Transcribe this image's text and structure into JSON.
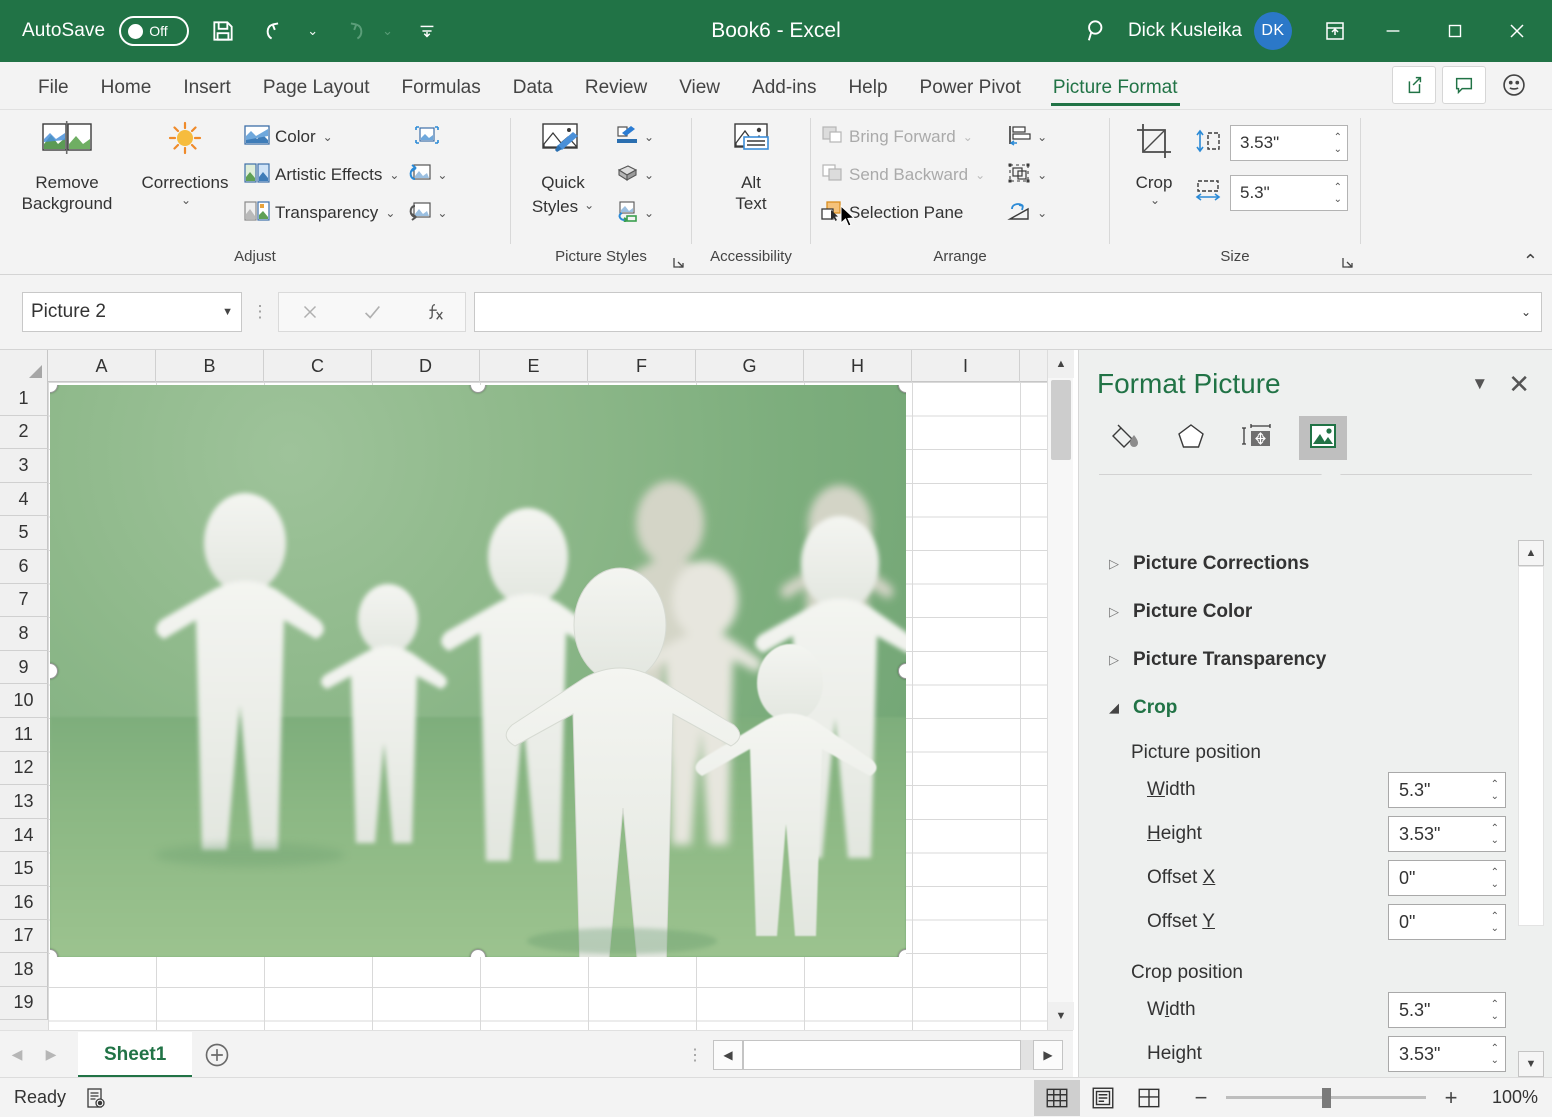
{
  "titlebar": {
    "autosave_label": "AutoSave",
    "autosave_state": "Off",
    "save_icon": "save-icon",
    "undo_icon": "undo-icon",
    "redo_icon": "redo-icon",
    "customize_qat_icon": "customize-quick-access-toolbar-icon",
    "document_title": "Book6  -  Excel",
    "search_icon": "search-icon",
    "user_name": "Dick Kusleika",
    "avatar_initials": "DK",
    "ribbon_display_icon": "ribbon-display-options-icon",
    "minimize_icon": "minimize-icon",
    "restore_icon": "restore-icon",
    "close_icon": "close-icon",
    "bg_color": "#217346"
  },
  "tabs": [
    {
      "label": "File",
      "active": false
    },
    {
      "label": "Home",
      "active": false
    },
    {
      "label": "Insert",
      "active": false
    },
    {
      "label": "Page Layout",
      "active": false
    },
    {
      "label": "Formulas",
      "active": false
    },
    {
      "label": "Data",
      "active": false
    },
    {
      "label": "Review",
      "active": false
    },
    {
      "label": "View",
      "active": false
    },
    {
      "label": "Add-ins",
      "active": false
    },
    {
      "label": "Help",
      "active": false
    },
    {
      "label": "Power Pivot",
      "active": false
    },
    {
      "label": "Picture Format",
      "active": true
    }
  ],
  "tabstrip_right": {
    "share_icon": "share-icon",
    "comments_icon": "comments-icon",
    "feedback_icon": "smiley-feedback-icon"
  },
  "ribbon": {
    "groups": [
      {
        "name": "Adjust",
        "big_buttons": [
          {
            "label_line1": "Remove",
            "label_line2": "Background",
            "icon": "remove-background-icon"
          },
          {
            "label_line1": "Corrections",
            "label_line2": "",
            "icon": "corrections-icon",
            "has_caret": true
          }
        ],
        "small_buttons": [
          {
            "label": "Color",
            "icon": "picture-color-icon",
            "caret": true
          },
          {
            "label": "Artistic Effects",
            "icon": "artistic-effects-icon",
            "caret": true
          },
          {
            "label": "Transparency",
            "icon": "picture-transparency-icon",
            "caret": true
          }
        ],
        "icon_buttons": [
          {
            "icon": "compress-pictures-icon",
            "caret": false
          },
          {
            "icon": "change-picture-icon",
            "caret": true
          },
          {
            "icon": "reset-picture-icon",
            "caret": true
          }
        ]
      },
      {
        "name": "Picture Styles",
        "big_buttons": [
          {
            "label_line1": "Quick",
            "label_line2": "Styles",
            "icon": "quick-styles-icon",
            "inline_caret": true
          }
        ],
        "icon_buttons": [
          {
            "icon": "picture-border-icon",
            "caret": true
          },
          {
            "icon": "picture-effects-icon",
            "caret": true
          },
          {
            "icon": "picture-layout-icon",
            "caret": true
          }
        ],
        "has_dialog_launcher": true
      },
      {
        "name": "Accessibility",
        "big_buttons": [
          {
            "label_line1": "Alt",
            "label_line2": "Text",
            "icon": "alt-text-icon"
          }
        ]
      },
      {
        "name": "Arrange",
        "small_buttons": [
          {
            "label": "Bring Forward",
            "icon": "bring-forward-icon",
            "caret": true,
            "disabled": true
          },
          {
            "label": "Send Backward",
            "icon": "send-backward-icon",
            "caret": true,
            "disabled": true
          },
          {
            "label": "Selection Pane",
            "icon": "selection-pane-icon",
            "caret": false,
            "disabled": false
          }
        ],
        "icon_buttons": [
          {
            "icon": "align-objects-icon",
            "caret": true
          },
          {
            "icon": "group-objects-icon",
            "caret": true
          },
          {
            "icon": "rotate-objects-icon",
            "caret": true
          }
        ]
      },
      {
        "name": "Size",
        "crop_label": "Crop",
        "crop_icon": "crop-icon",
        "fields": [
          {
            "icon": "shape-height-icon",
            "value": "3.53\"",
            "name": "shape-height"
          },
          {
            "icon": "shape-width-icon",
            "value": "5.3\"",
            "name": "shape-width"
          }
        ],
        "has_dialog_launcher": true
      }
    ],
    "collapse_icon": "collapse-ribbon-icon"
  },
  "formula_bar": {
    "name_box_value": "Picture 2",
    "cancel_icon": "cancel-icon",
    "enter_icon": "enter-checkmark-icon",
    "insert_function_icon": "insert-function-icon",
    "formula_value": "",
    "expand_icon": "expand-formula-bar-icon"
  },
  "grid": {
    "columns": [
      "A",
      "B",
      "C",
      "D",
      "E",
      "F",
      "G",
      "H",
      "I"
    ],
    "rows": [
      1,
      2,
      3,
      4,
      5,
      6,
      7,
      8,
      9,
      10,
      11,
      12,
      13,
      14,
      15,
      16,
      17,
      18,
      19
    ],
    "select_all_icon": "select-all-icon"
  },
  "picture": {
    "name": "Picture 2",
    "alt_description": "White paper cut-out human figures holding hands on a green background",
    "selected": true,
    "handle_count": 8
  },
  "sheet_bar": {
    "prev_icon": "previous-sheet-icon",
    "next_icon": "next-sheet-icon",
    "tabs": [
      {
        "label": "Sheet1",
        "active": true
      }
    ],
    "add_sheet_icon": "add-sheet-icon",
    "more_icon": "sheet-tab-more-icon",
    "hscroll_left_icon": "scroll-left-icon",
    "hscroll_right_icon": "scroll-right-icon"
  },
  "status_bar": {
    "state": "Ready",
    "accessibility_icon": "accessibility-checker-icon",
    "views": [
      {
        "name": "normal-view",
        "icon": "normal-view-icon",
        "selected": true
      },
      {
        "name": "page-layout-view",
        "icon": "page-layout-view-icon",
        "selected": false
      },
      {
        "name": "page-break-preview",
        "icon": "page-break-preview-icon",
        "selected": false
      }
    ],
    "zoom_out_icon": "zoom-out-icon",
    "zoom_in_icon": "zoom-in-icon",
    "zoom_level": "100%"
  },
  "format_pane": {
    "title": "Format Picture",
    "dropdown_icon": "pane-options-icon",
    "close_icon": "close-pane-icon",
    "tabs": [
      {
        "name": "fill-and-line",
        "icon": "paint-bucket-icon",
        "selected": false
      },
      {
        "name": "effects",
        "icon": "pentagon-effects-icon",
        "selected": false
      },
      {
        "name": "size-and-properties",
        "icon": "size-properties-icon",
        "selected": false
      },
      {
        "name": "picture",
        "icon": "picture-icon",
        "selected": true
      }
    ],
    "sections": [
      {
        "label": "Picture Corrections",
        "expanded": false
      },
      {
        "label": "Picture Color",
        "expanded": false
      },
      {
        "label": "Picture Transparency",
        "expanded": false
      },
      {
        "label": "Crop",
        "expanded": true
      }
    ],
    "crop": {
      "picture_position_label": "Picture position",
      "picture_position_fields": [
        {
          "label": "Width",
          "accel": "W",
          "value": "5.3\""
        },
        {
          "label": "Height",
          "accel": "H",
          "value": "3.53\""
        },
        {
          "label": "Offset X",
          "accel": "X",
          "value": "0\""
        },
        {
          "label": "Offset Y",
          "accel": "Y",
          "value": "0\""
        }
      ],
      "crop_position_label": "Crop position",
      "crop_position_fields": [
        {
          "label": "Width",
          "accel": "i",
          "value": "5.3\""
        },
        {
          "label": "Height",
          "accel": "g",
          "value": "3.53\""
        }
      ]
    },
    "scroll_up_icon": "scroll-up-icon",
    "scroll_down_icon": "scroll-down-icon"
  }
}
